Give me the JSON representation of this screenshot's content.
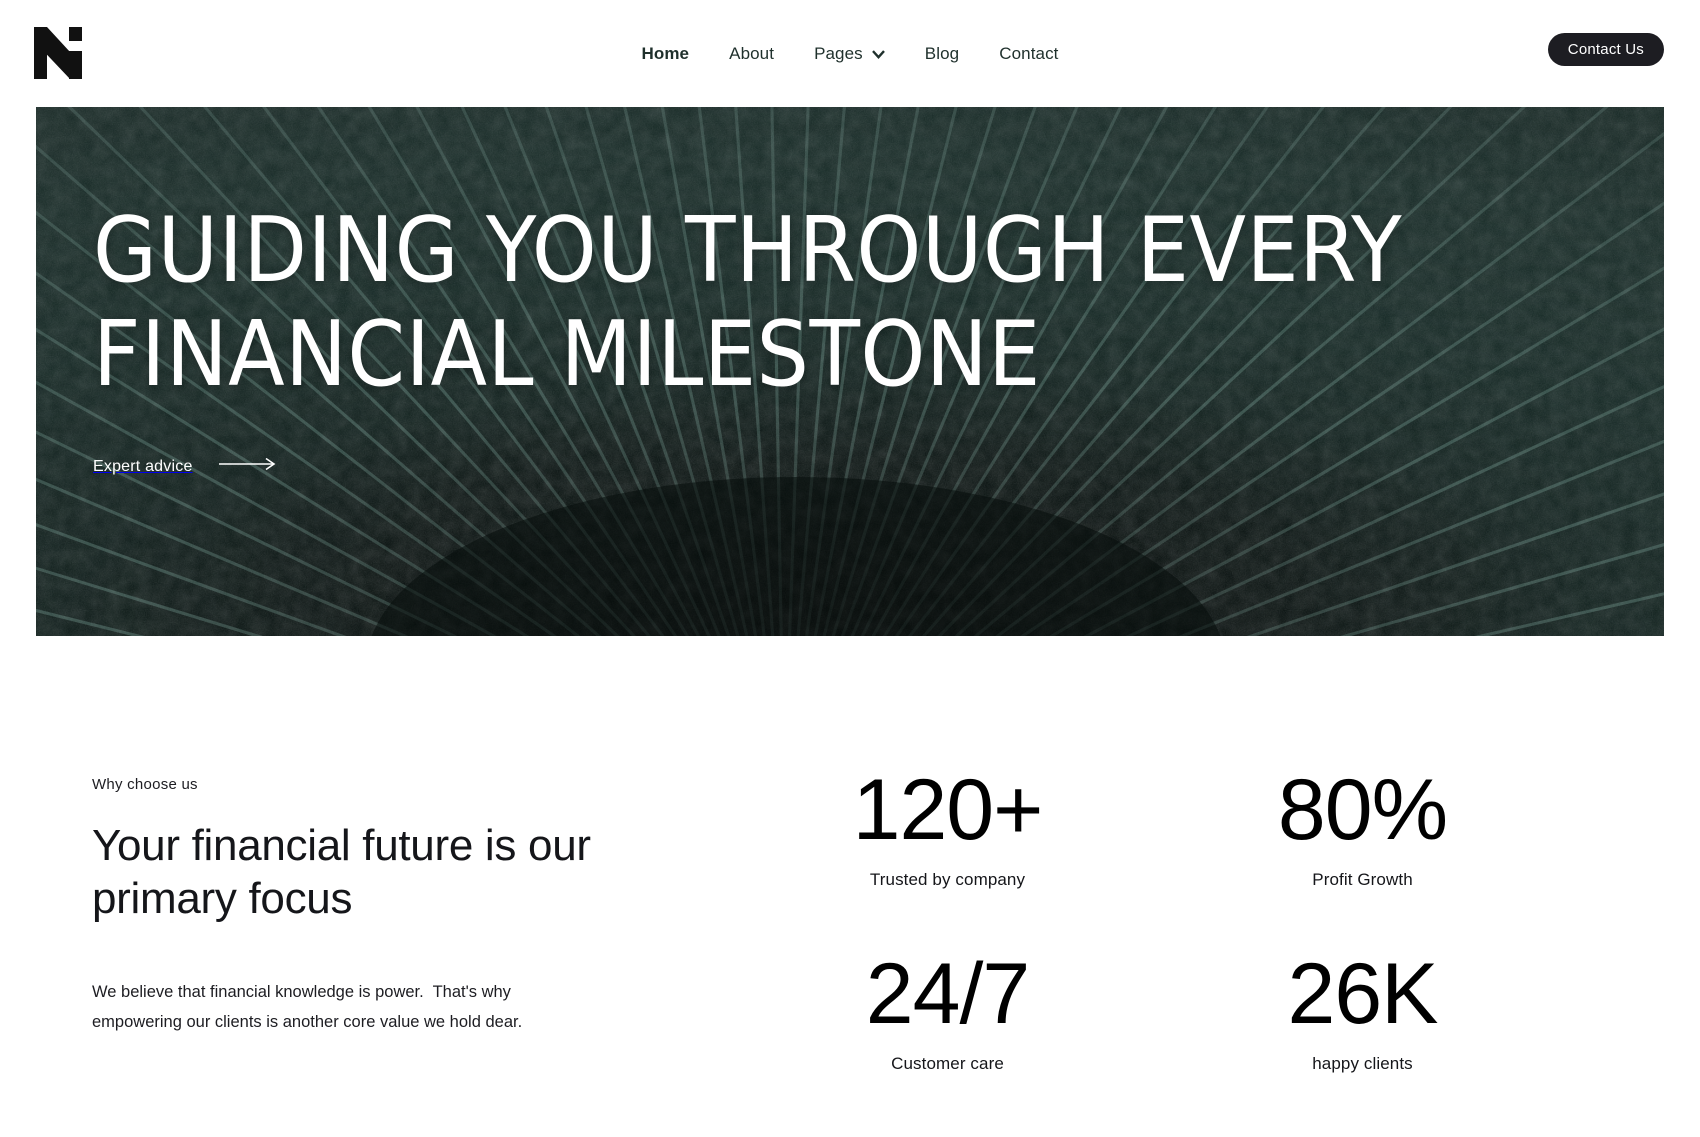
{
  "header": {
    "logo_name": "logo-n-mark",
    "nav": [
      {
        "label": "Home",
        "active": true,
        "has_chevron": false
      },
      {
        "label": "About",
        "active": false,
        "has_chevron": false
      },
      {
        "label": "Pages",
        "active": false,
        "has_chevron": true
      },
      {
        "label": "Blog",
        "active": false,
        "has_chevron": false
      },
      {
        "label": "Contact",
        "active": false,
        "has_chevron": false
      }
    ],
    "cta_label": "Contact Us"
  },
  "hero": {
    "title_line_1": "GUIDING YOU THROUGH EVERY",
    "title_line_2": "FINANCIAL MILESTONE",
    "link_label": "Expert advice",
    "arrow_icon": "arrow-right-icon",
    "background_description": "dark teal radial ridged texture"
  },
  "why": {
    "eyebrow": "Why choose us",
    "heading": "Your financial future is our primary focus",
    "body": "We believe that financial knowledge is power.  That's why empowering our clients is another core value we hold dear."
  },
  "stats": [
    {
      "value": "120+",
      "label": "Trusted by company"
    },
    {
      "value": "80%",
      "label": "Profit Growth"
    },
    {
      "value": "24/7",
      "label": "Customer care"
    },
    {
      "value": "26K",
      "label": "happy clients"
    }
  ],
  "colors": {
    "page_background": "#ffffff",
    "text_primary": "#15161a",
    "nav_text": "#1f302c",
    "cta_background": "#1d1d22",
    "cta_text": "#ffffff",
    "hero_dark": "#0d1c19",
    "hero_ridge": "#2e4a44",
    "hero_text": "#ffffff"
  }
}
